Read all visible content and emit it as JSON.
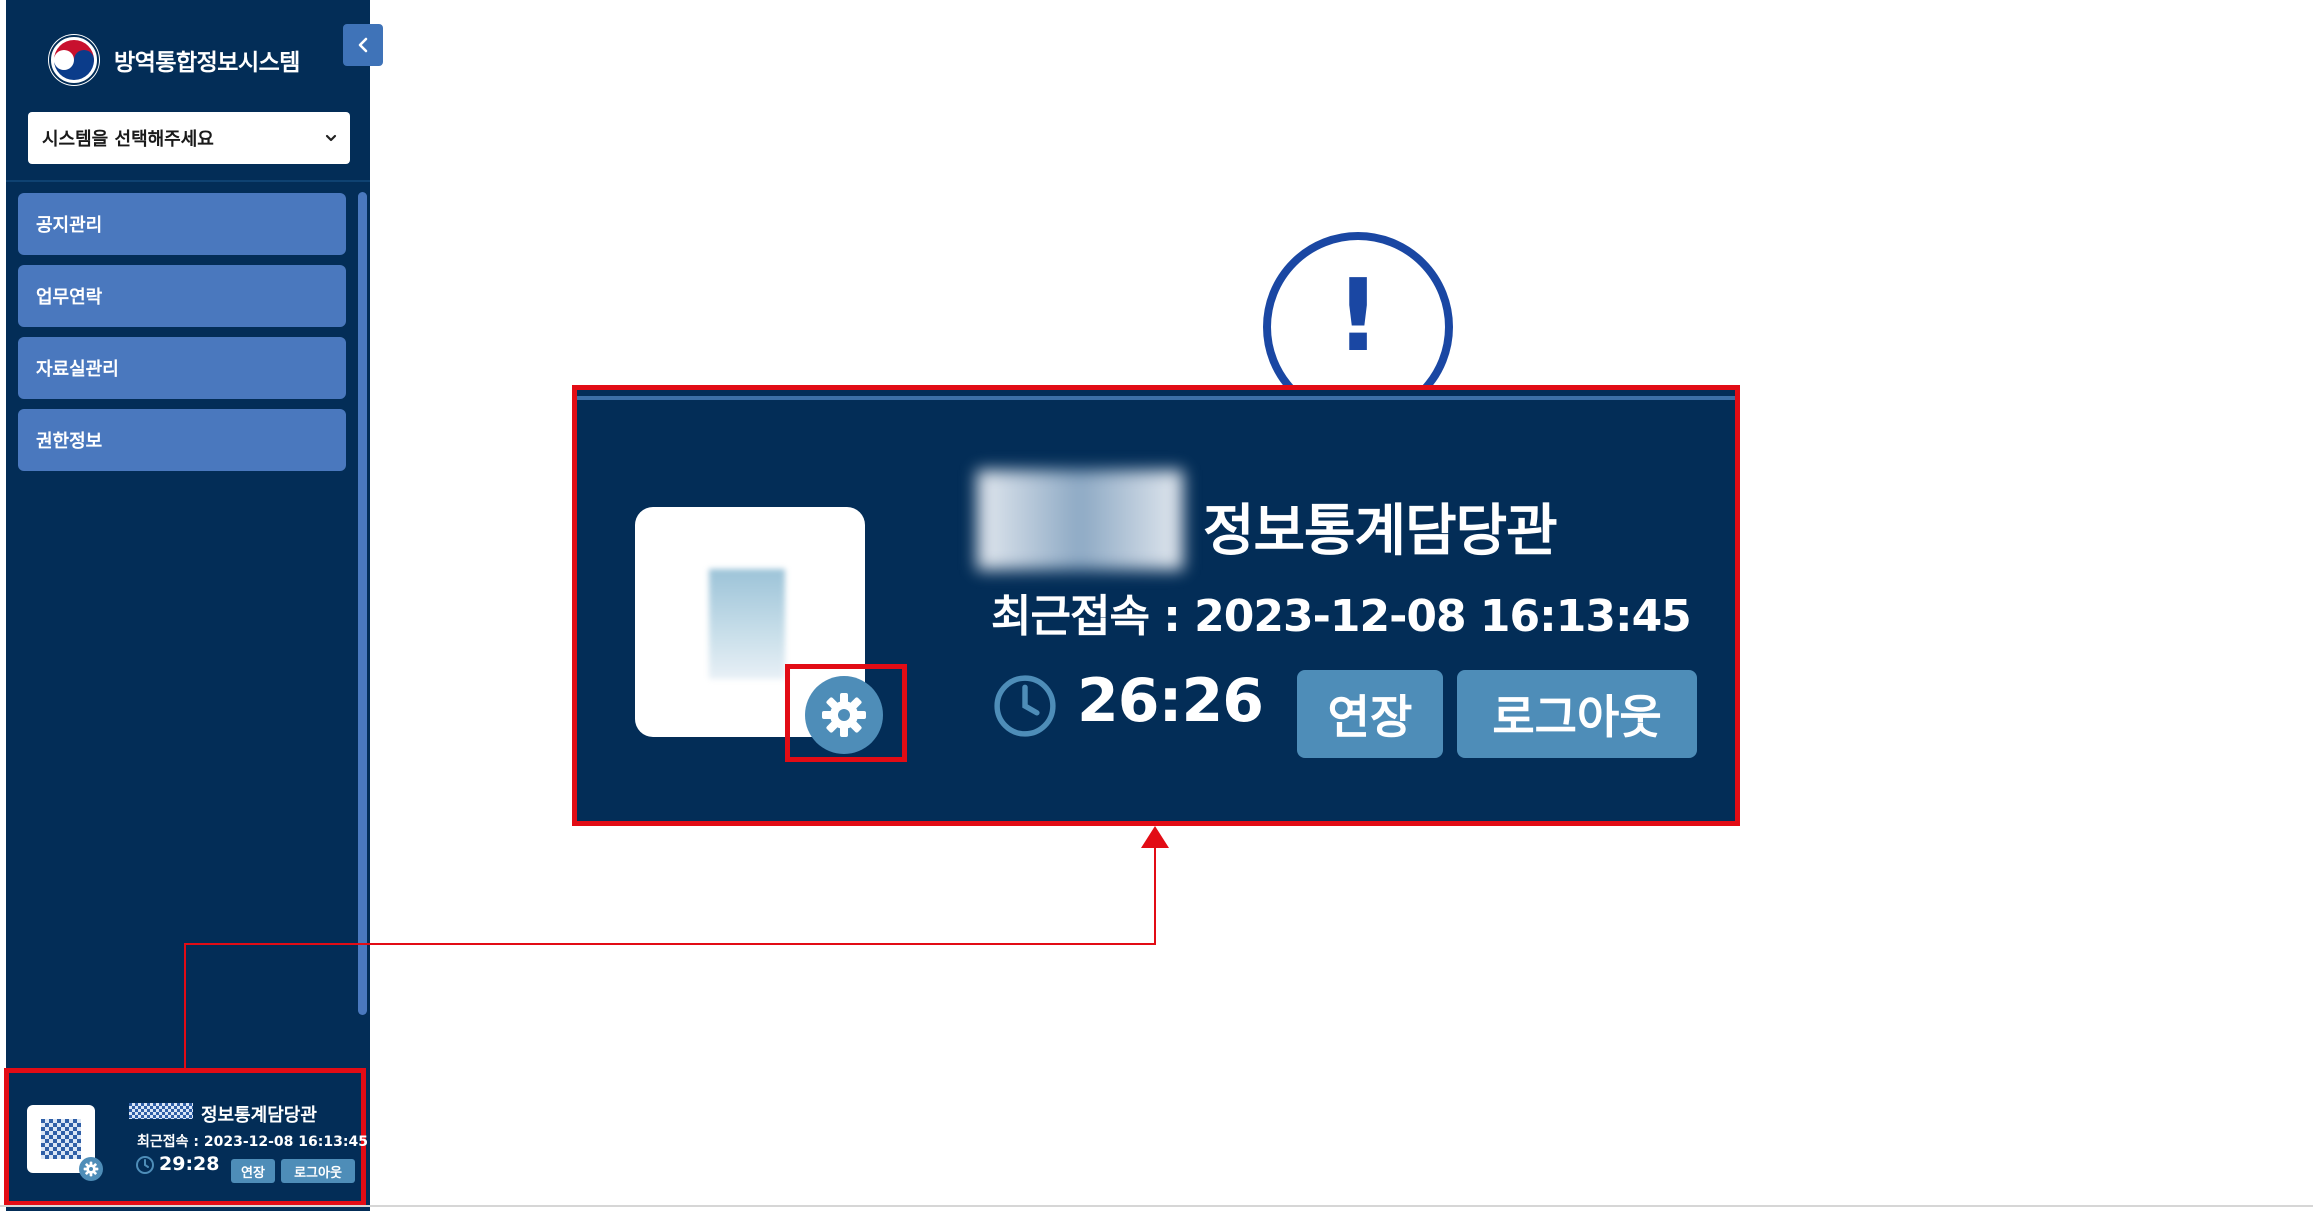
{
  "app": {
    "title": "방역통합정보시스템"
  },
  "system_select": {
    "placeholder": "시스템을 선택해주세요"
  },
  "sidebar": {
    "items": [
      {
        "label": "공지관리"
      },
      {
        "label": "업무연락"
      },
      {
        "label": "자료실관리"
      },
      {
        "label": "권한정보"
      }
    ]
  },
  "user_panel": {
    "title": "정보통계담당관",
    "last_login_label": "최근접속 : 2023-12-08 16:13:45",
    "session_timer": "29:28",
    "extend_label": "연장",
    "logout_label": "로그아웃"
  },
  "zoomed_panel": {
    "title": "정보통계담당관",
    "last_login_label": "최근접속 : 2023-12-08 16:13:45",
    "session_timer": "26:26",
    "extend_label": "연장",
    "logout_label": "로그아웃"
  },
  "alert": {
    "symbol": "!"
  },
  "colors": {
    "sidebar_bg": "#032d57",
    "menu_item": "#4a78be",
    "button": "#4e8db8",
    "highlight": "#e20c15",
    "alert": "#1a47a3"
  },
  "icons": [
    "logo-emblem-icon",
    "chevron-left-icon",
    "chevron-down-icon",
    "clock-icon",
    "gear-icon",
    "exclamation-icon"
  ]
}
